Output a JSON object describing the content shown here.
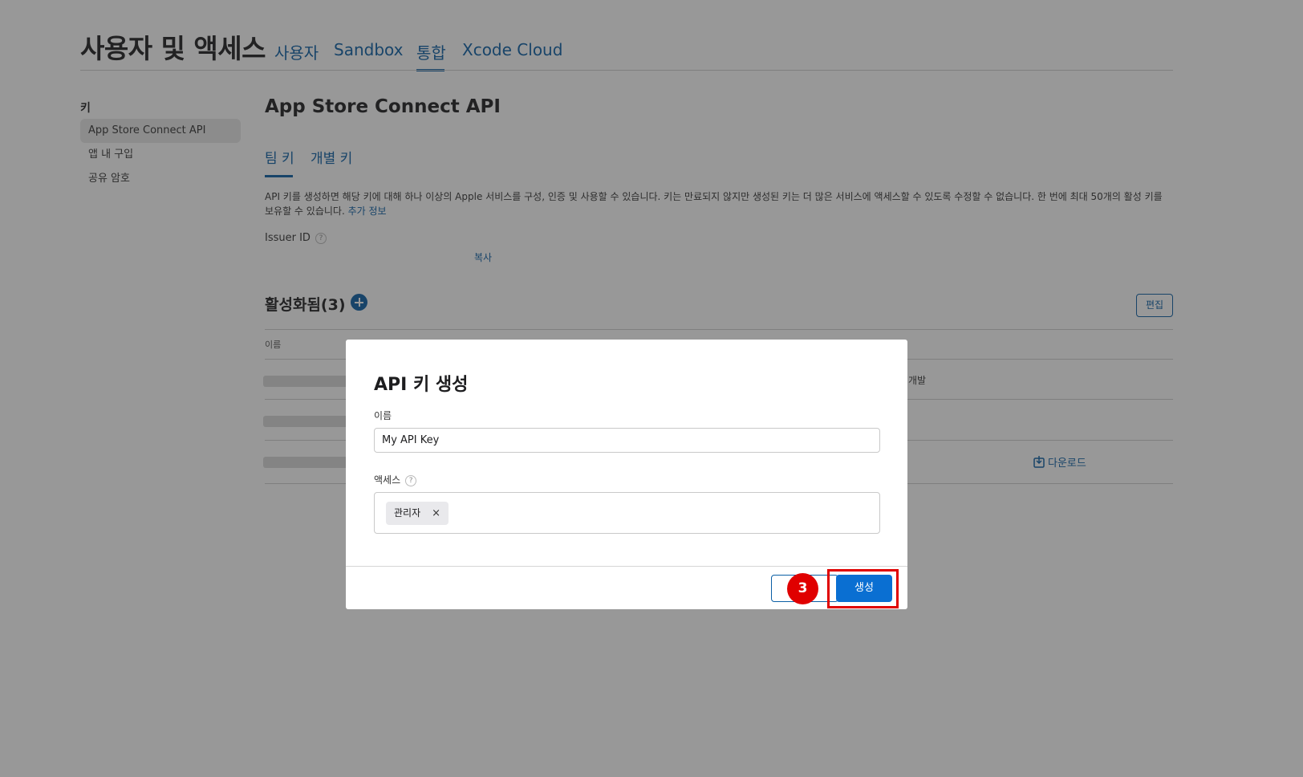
{
  "header": {
    "title": "사용자 및 액세스",
    "tabs": [
      {
        "label": "사용자"
      },
      {
        "label": "Sandbox"
      },
      {
        "label": "통합"
      },
      {
        "label": "Xcode Cloud"
      }
    ],
    "active_tab": "통합"
  },
  "sidebar": {
    "heading": "키",
    "items": [
      {
        "label": "App Store Connect API",
        "selected": true
      },
      {
        "label": "앱 내 구입",
        "selected": false
      },
      {
        "label": "공유 암호",
        "selected": false
      }
    ]
  },
  "main": {
    "title": "App Store Connect API",
    "tabs": [
      {
        "label": "팀 키"
      },
      {
        "label": "개별 키"
      }
    ],
    "description": "API 키를 생성하면 해당 키에 대해 하나 이상의 Apple 서비스를 구성, 인증 및 사용할 수 있습니다. 키는 만료되지 않지만 생성된 키는 더 많은 서비스에 액세스할 수 있도록 수정할 수 없습니다. 한 번에 최대 50개의 활성 키를 보유할 수 있습니다.",
    "more_info_link": "추가 정보",
    "issuer_label": "Issuer ID",
    "help_symbol": "?",
    "copy_label": "복사",
    "active_section_title": "활성화됨(3)",
    "edit_label": "편집",
    "table_column_name": "이름",
    "peek_text": "개발",
    "download_label": "다운로드"
  },
  "modal": {
    "title": "API 키 생성",
    "name_label": "이름",
    "name_value": "My API Key",
    "access_label": "액세스",
    "access_help": "?",
    "access_token": "관리자",
    "token_remove": "×",
    "create_label": "생성",
    "step_number": "3"
  },
  "colors": {
    "accent": "#0b5fa5",
    "primary_button": "#0a6fd2",
    "highlight": "#e00000",
    "overlay": "rgba(40,40,40,0.48)"
  }
}
